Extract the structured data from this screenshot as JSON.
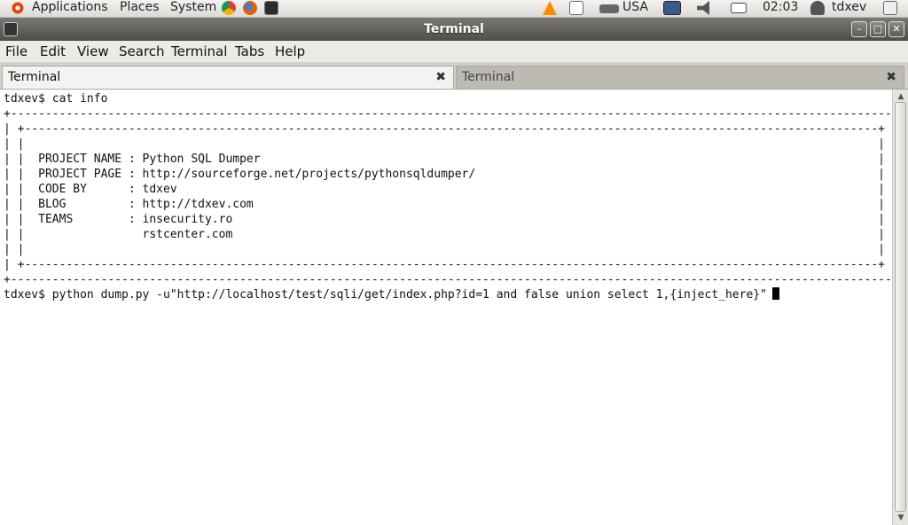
{
  "panel": {
    "applications": "Applications",
    "places": "Places",
    "system": "System",
    "keyboard_layout": "USA",
    "clock": "02:03",
    "user": "tdxev"
  },
  "window": {
    "title": "Terminal",
    "minimize": "–",
    "maximize": "□",
    "close": "✕"
  },
  "menubar": [
    "File",
    "Edit",
    "View",
    "Search",
    "Terminal",
    "Tabs",
    "Help"
  ],
  "tabs": [
    {
      "label": "Terminal",
      "close": "✖"
    },
    {
      "label": "Terminal",
      "close": "✖"
    }
  ],
  "terminal": {
    "lines": [
      "tdxev$ cat info",
      "+-------------------------------------------------------------------------------------------------------------------------------+",
      "| +---------------------------------------------------------------------------------------------------------------------------+ |",
      "| |                                                                                                                           | |",
      "| |  PROJECT NAME : Python SQL Dumper                                                                                         | |",
      "| |  PROJECT PAGE : http://sourceforge.net/projects/pythonsqldumper/                                                          | |",
      "| |  CODE BY      : tdxev                                                                                                     | |",
      "| |  BLOG         : http://tdxev.com                                                                                          | |",
      "| |  TEAMS        : insecurity.ro                                                                                             | |",
      "| |                 rstcenter.com                                                                                             | |",
      "| |                                                                                                                           | |",
      "| +---------------------------------------------------------------------------------------------------------------------------+ |",
      "+-------------------------------------------------------------------------------------------------------------------------------+"
    ],
    "command_line": "tdxev$ python dump.py -u\"http://localhost/test/sqli/get/index.php?id=1 and false union select 1,{inject_here}\""
  },
  "colors": {
    "panel": "#dcdad5",
    "titlebar": "#4f4d48",
    "terminal_bg": "#ffffff",
    "terminal_fg": "#111111"
  }
}
